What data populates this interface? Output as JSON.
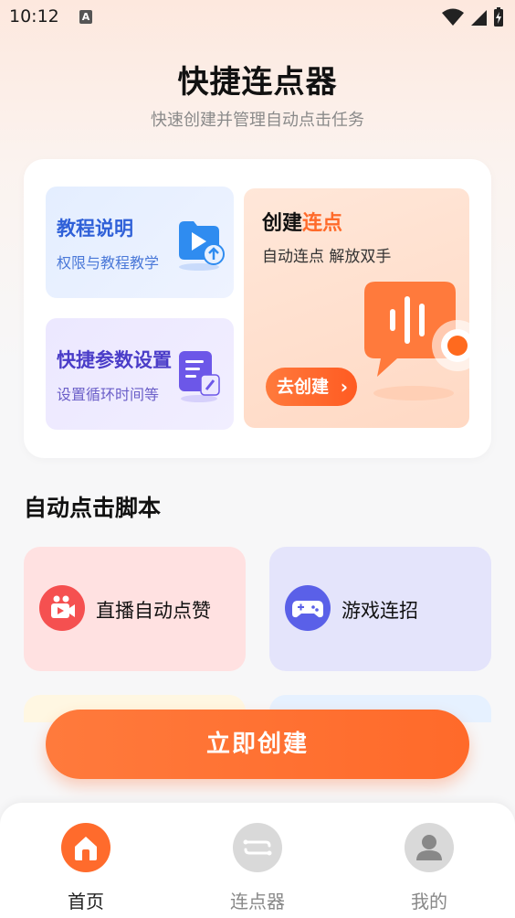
{
  "status": {
    "time": "10:12",
    "notif": "A"
  },
  "header": {
    "title": "快捷连点器",
    "subtitle": "快速创建并管理自动点击任务"
  },
  "cards": {
    "tutorial": {
      "title": "教程说明",
      "subtitle": "权限与教程教学",
      "icon": "video-upload-icon"
    },
    "params": {
      "title": "快捷参数设置",
      "subtitle": "设置循环时间等",
      "icon": "document-edit-icon"
    },
    "create": {
      "title_prefix": "创建",
      "title_accent": "连点",
      "subtitle": "自动连点 解放双手",
      "button": "去创建",
      "icon": "voice-bubble-icon"
    }
  },
  "scripts": {
    "title": "自动点击脚本",
    "items": [
      {
        "label": "直播自动点赞",
        "icon": "live-video-icon"
      },
      {
        "label": "游戏连招",
        "icon": "gamepad-icon"
      }
    ]
  },
  "cta": {
    "label": "立即创建"
  },
  "tabbar": {
    "items": [
      {
        "label": "首页",
        "icon": "home-icon",
        "active": true
      },
      {
        "label": "连点器",
        "icon": "clicker-icon",
        "active": false
      },
      {
        "label": "我的",
        "icon": "user-icon",
        "active": false
      }
    ]
  },
  "colors": {
    "accent": "#ff6a2a",
    "tutorial": "#2f60d8",
    "params": "#4a3cc8",
    "live": "#f55050",
    "game": "#5a60e8"
  }
}
